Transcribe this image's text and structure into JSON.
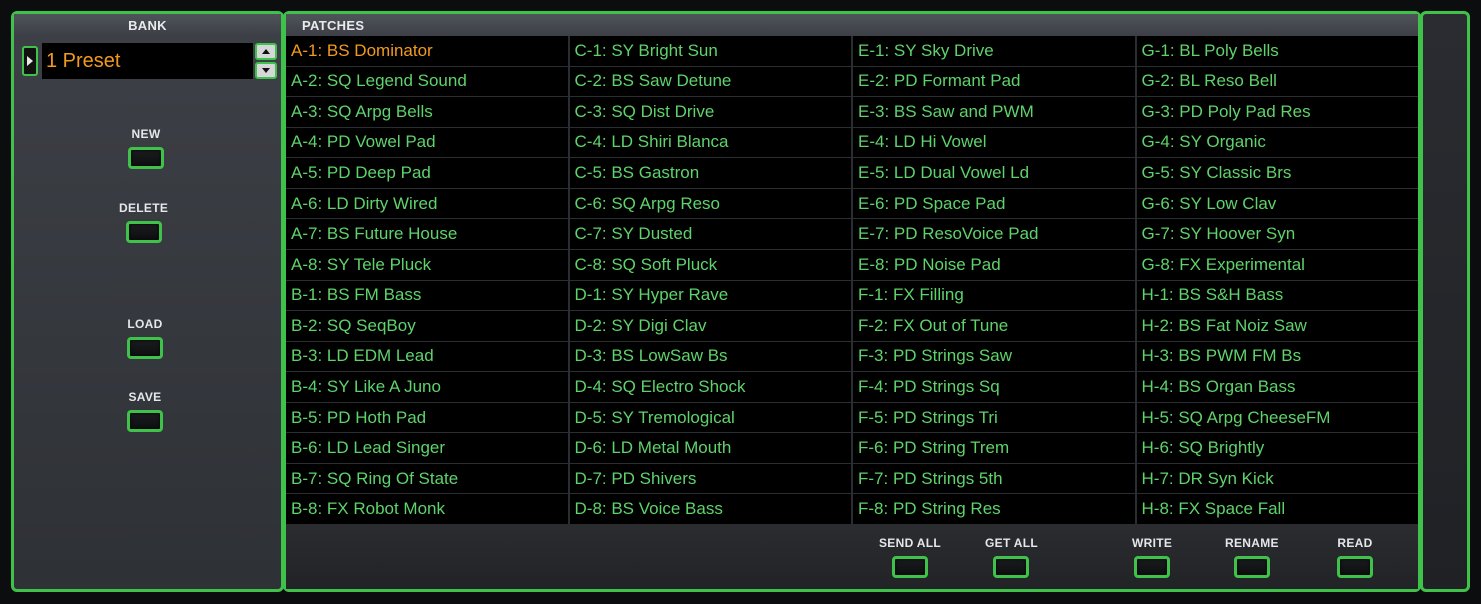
{
  "bank": {
    "header": "BANK",
    "value": "1 Preset",
    "buttons": {
      "new": "NEW",
      "delete": "DELETE",
      "load": "LOAD",
      "save": "SAVE"
    }
  },
  "patches": {
    "header": "PATCHES",
    "selected": "A-1: BS Dominator",
    "items": [
      "A-1: BS Dominator",
      "A-2: SQ Legend Sound",
      "A-3: SQ Arpg Bells",
      "A-4: PD Vowel Pad",
      "A-5: PD Deep Pad",
      "A-6: LD Dirty Wired",
      "A-7: BS Future House",
      "A-8: SY Tele Pluck",
      "B-1: BS FM Bass",
      "B-2: SQ SeqBoy",
      "B-3: LD EDM Lead",
      "B-4: SY Like A Juno",
      "B-5: PD Hoth Pad",
      "B-6: LD Lead Singer",
      "B-7: SQ Ring Of State",
      "B-8: FX Robot Monk",
      "C-1: SY Bright Sun",
      "C-2: BS Saw Detune",
      "C-3: SQ Dist Drive",
      "C-4: LD Shiri Blanca",
      "C-5: BS Gastron",
      "C-6: SQ Arpg Reso",
      "C-7: SY Dusted",
      "C-8: SQ Soft Pluck",
      "D-1: SY Hyper Rave",
      "D-2: SY Digi Clav",
      "D-3: BS LowSaw Bs",
      "D-4: SQ Electro Shock",
      "D-5: SY Tremological",
      "D-6: LD Metal Mouth",
      "D-7: PD Shivers",
      "D-8: BS Voice Bass",
      "E-1: SY Sky Drive",
      "E-2: PD Formant Pad",
      "E-3: BS Saw and PWM",
      "E-4: LD Hi Vowel",
      "E-5: LD Dual Vowel Ld",
      "E-6: PD Space Pad",
      "E-7: PD ResoVoice Pad",
      "E-8: PD Noise Pad",
      "F-1: FX Filling",
      "F-2: FX Out of Tune",
      "F-3: PD Strings Saw",
      "F-4: PD Strings Sq",
      "F-5: PD Strings Tri",
      "F-6: PD String Trem",
      "F-7: PD Strings 5th",
      "F-8: PD String Res",
      "G-1: BL Poly Bells",
      "G-2: BL Reso Bell",
      "G-3: PD Poly Pad Res",
      "G-4: SY Organic",
      "G-5: SY Classic Brs",
      "G-6: SY Low Clav",
      "G-7: SY Hoover Syn",
      "G-8: FX Experimental",
      "H-1: BS S&H Bass",
      "H-2: BS Fat Noiz Saw",
      "H-3: BS PWM FM Bs",
      "H-4: BS Organ Bass",
      "H-5: SQ Arpg CheeseFM",
      "H-6: SQ Brightly",
      "H-7: DR Syn Kick",
      "H-8: FX Space Fall"
    ],
    "footer_buttons": {
      "send_all": "SEND ALL",
      "get_all": "GET ALL",
      "write": "WRITE",
      "rename": "RENAME",
      "read": "READ"
    }
  },
  "colors": {
    "accent_green": "#3fc24a",
    "patch_text": "#5fd36b",
    "selected_text": "#f39a1e"
  }
}
